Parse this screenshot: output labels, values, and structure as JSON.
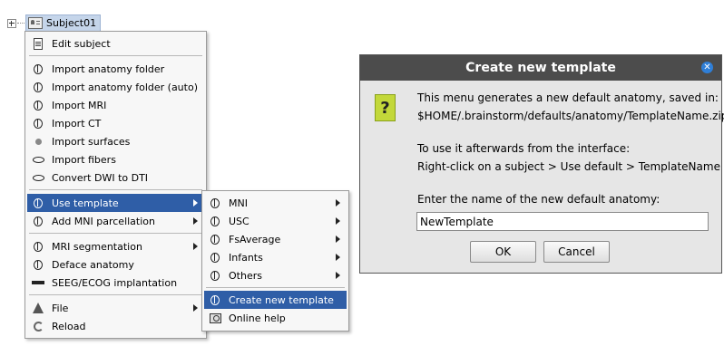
{
  "tree": {
    "node_label": "Subject01"
  },
  "context_menu": {
    "items": [
      {
        "label": "Edit subject"
      },
      {
        "label": "Import anatomy folder"
      },
      {
        "label": "Import anatomy folder (auto)"
      },
      {
        "label": "Import MRI"
      },
      {
        "label": "Import CT"
      },
      {
        "label": "Import surfaces"
      },
      {
        "label": "Import fibers"
      },
      {
        "label": "Convert DWI to DTI"
      },
      {
        "label": "Use template"
      },
      {
        "label": "Add MNI parcellation"
      },
      {
        "label": "MRI segmentation"
      },
      {
        "label": "Deface anatomy"
      },
      {
        "label": "SEEG/ECOG implantation"
      },
      {
        "label": "File"
      },
      {
        "label": "Reload"
      }
    ]
  },
  "submenu": {
    "items": [
      {
        "label": "MNI"
      },
      {
        "label": "USC"
      },
      {
        "label": "FsAverage"
      },
      {
        "label": "Infants"
      },
      {
        "label": "Others"
      },
      {
        "label": "Create new template"
      },
      {
        "label": "Online help"
      }
    ]
  },
  "dialog": {
    "title": "Create new template",
    "line1": "This menu generates a new default anatomy, saved in:",
    "line2": "$HOME/.brainstorm/defaults/anatomy/TemplateName.zip",
    "line3": "To use it afterwards from the interface:",
    "line4": "Right-click on a subject > Use default > TemplateName",
    "prompt": "Enter the name of the new default anatomy:",
    "input_value": "NewTemplate",
    "ok_label": "OK",
    "cancel_label": "Cancel",
    "question_glyph": "?",
    "close_glyph": "✕"
  },
  "colors": {
    "menu_highlight": "#2f5ea7",
    "dialog_title_bg": "#4c4c4c",
    "question_icon": "#c3d83a",
    "close_button": "#2f7fd8"
  }
}
